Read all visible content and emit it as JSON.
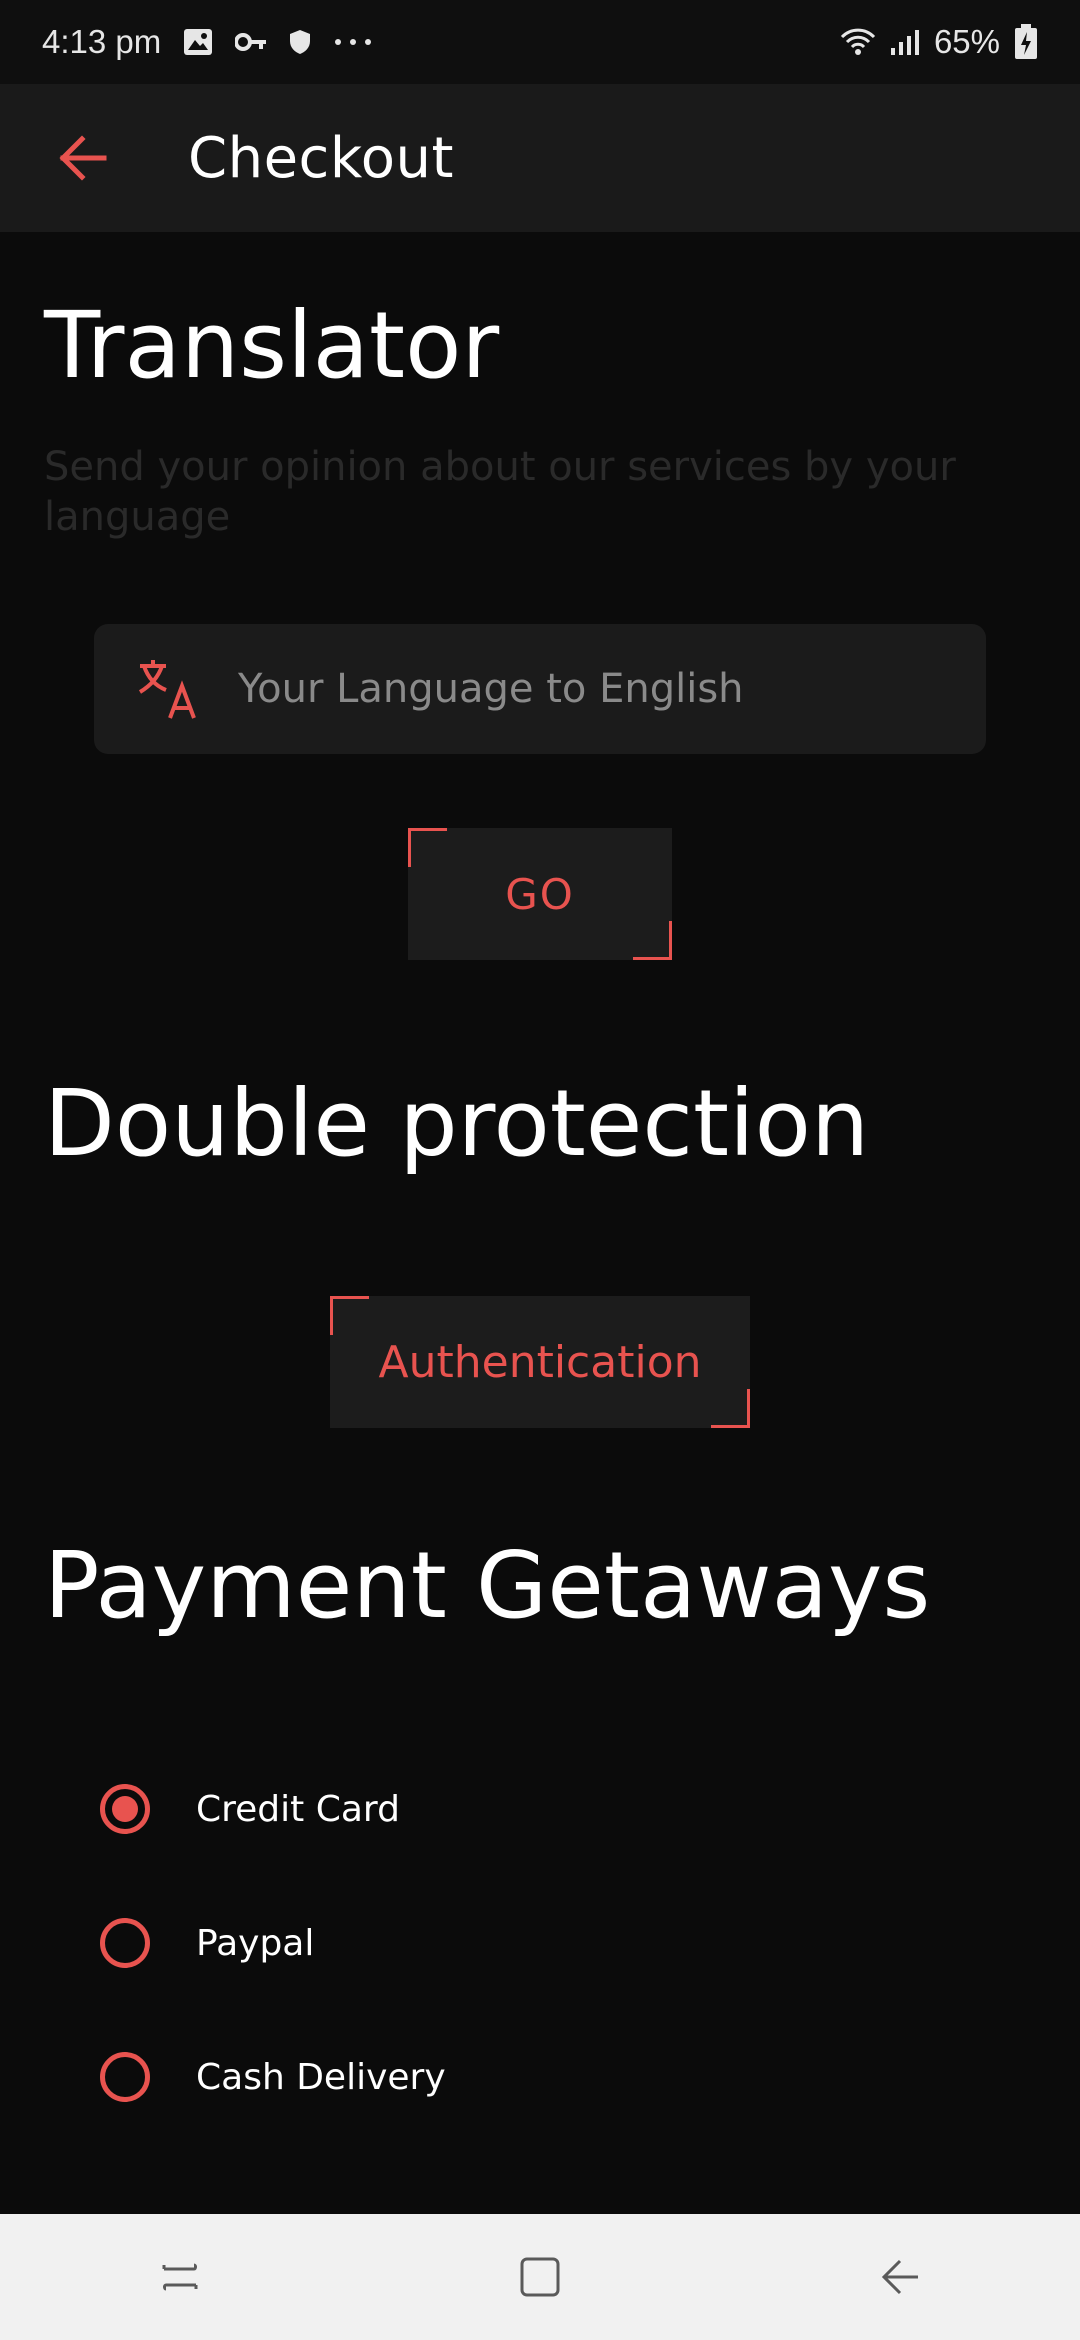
{
  "status_bar": {
    "time": "4:13 pm",
    "battery": "65%",
    "icons_left": [
      "image-icon",
      "key-icon",
      "shield-icon",
      "more-icon"
    ],
    "icons_right": [
      "wifi-icon",
      "signal-icon",
      "battery-icon"
    ]
  },
  "app_bar": {
    "title": "Checkout",
    "back_icon": "arrow-left-icon"
  },
  "translator": {
    "title": "Translator",
    "subtitle": "Send your opinion about our services by your language",
    "input_placeholder": "Your Language to English",
    "input_icon": "translate-icon",
    "go_label": "GO"
  },
  "protection": {
    "title": "Double protection",
    "button_label": "Authentication"
  },
  "payment": {
    "title": "Payment Getaways",
    "options": [
      {
        "label": "Credit Card",
        "selected": true
      },
      {
        "label": "Paypal",
        "selected": false
      },
      {
        "label": "Cash Delivery",
        "selected": false
      }
    ]
  },
  "nav_bar": {
    "buttons": [
      "recents-icon",
      "home-icon",
      "back-icon"
    ]
  },
  "colors": {
    "accent": "#e8534f",
    "background": "#0b0b0b",
    "surface": "#1b1b1b"
  }
}
